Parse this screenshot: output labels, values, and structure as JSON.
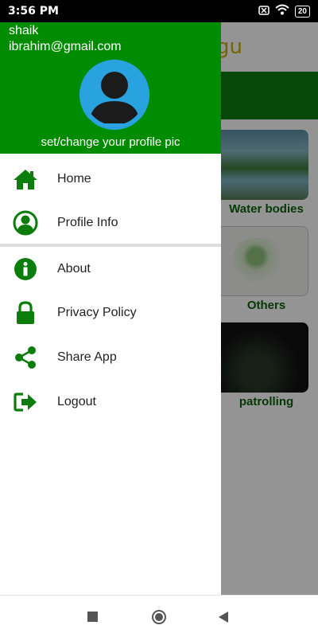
{
  "status_bar": {
    "time": "3:56 PM",
    "battery": "20"
  },
  "background_app": {
    "title_fragment": "gu",
    "cards": [
      {
        "label": "Water bodies"
      },
      {
        "label": "Others"
      },
      {
        "label": "patrolling"
      }
    ]
  },
  "drawer": {
    "user_name": "shaik",
    "user_email": "ibrahim@gmail.com",
    "profile_pic_hint": "set/change your profile pic",
    "menu_primary": [
      {
        "label": "Home",
        "icon": "home-icon"
      },
      {
        "label": "Profile Info",
        "icon": "account-circle-icon"
      }
    ],
    "menu_secondary": [
      {
        "label": "About",
        "icon": "info-icon"
      },
      {
        "label": "Privacy Policy",
        "icon": "lock-icon"
      },
      {
        "label": "Share App",
        "icon": "share-icon"
      },
      {
        "label": "Logout",
        "icon": "logout-icon"
      }
    ]
  },
  "nav_bar": {
    "buttons": [
      "recent-apps-icon",
      "home-circle-icon",
      "back-icon"
    ]
  },
  "colors": {
    "header_green": "#008c00",
    "icon_green": "#0a7d0a",
    "avatar_blue": "#29a3e0"
  }
}
